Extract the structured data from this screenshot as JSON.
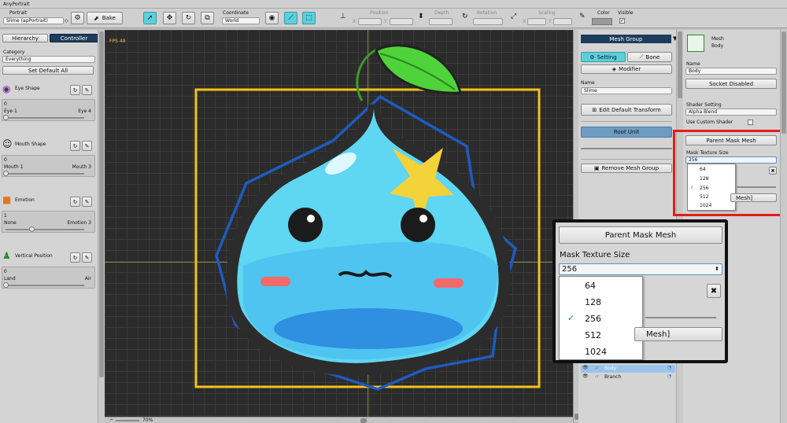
{
  "window": {
    "title": "AnyPortrait"
  },
  "toolbar": {
    "portrait_label": "Portrait",
    "portrait_value": "Slime (apPortrait)",
    "bake_label": "Bake",
    "coordinate_label": "Coordinate",
    "coordinate_value": "World",
    "position_label": "Position",
    "depth_label": "Depth",
    "rotation_label": "Rotation",
    "scaling_label": "Scaling",
    "color_label": "Color",
    "visible_label": "Visible",
    "x_label": "X",
    "y_label": "Y"
  },
  "left": {
    "tabs": [
      "Hierarchy",
      "Controller"
    ],
    "category_label": "Category",
    "category_value": "Everything",
    "set_default_all": "Set Default All",
    "controls": [
      {
        "name": "Eye Shape",
        "value": "0",
        "min": "Eye 1",
        "max": "Eye 4",
        "level": 0.0
      },
      {
        "name": "Mouth Shape",
        "value": "0",
        "min": "Mouth 1",
        "max": "Mouth 3",
        "level": 0.0
      },
      {
        "name": "Emotion",
        "value": "1",
        "min": "None",
        "max": "Emotion 3",
        "level": 0.33
      },
      {
        "name": "Vertical Position",
        "value": "0",
        "min": "Land",
        "max": "Air",
        "level": 0.0
      }
    ]
  },
  "canvas": {
    "fps": "FPS 49",
    "zoom": "70%"
  },
  "mid": {
    "mesh_group_label": "Mesh Group",
    "tab_setting": "Setting",
    "tab_bone": "Bone",
    "modifier": "Modifier",
    "name_label": "Name",
    "name_value": "Slime",
    "edit_default_transform": "Edit Default Transform",
    "root_unit": "Root Unit",
    "remove_mesh_group": "Remove Mesh Group",
    "layers": [
      "Body",
      "Branch"
    ]
  },
  "right": {
    "type_label": "Mesh",
    "type_name": "Body",
    "name_label": "Name",
    "name_value": "Body",
    "socket_disabled": "Socket Disabled",
    "shader_setting": "Shader Setting",
    "shader_value": "Alpha Blend",
    "use_custom_shader": "Use Custom Shader",
    "parent_mask_mesh": "Parent Mask Mesh",
    "mask_texture_size": "Mask Texture Size",
    "mask_texture_value": "256",
    "mask_options": [
      "64",
      "128",
      "256",
      "512",
      "1024"
    ],
    "selected_option": "256",
    "mesh_fragment": "Mesh]"
  },
  "zoom_popup": {
    "parent_mask_mesh": "Parent Mask Mesh",
    "mask_texture_size": "Mask Texture Size",
    "value": "256",
    "options": [
      "64",
      "128",
      "256",
      "512",
      "1024"
    ],
    "selected": "256",
    "mesh_fragment": "Mesh]"
  },
  "colors": {
    "accent": "#5bd0dc",
    "highlight": "#e51b1b",
    "select": "#9bc4ec",
    "bounding": "#f2c318",
    "outline": "#1e5bbf"
  }
}
